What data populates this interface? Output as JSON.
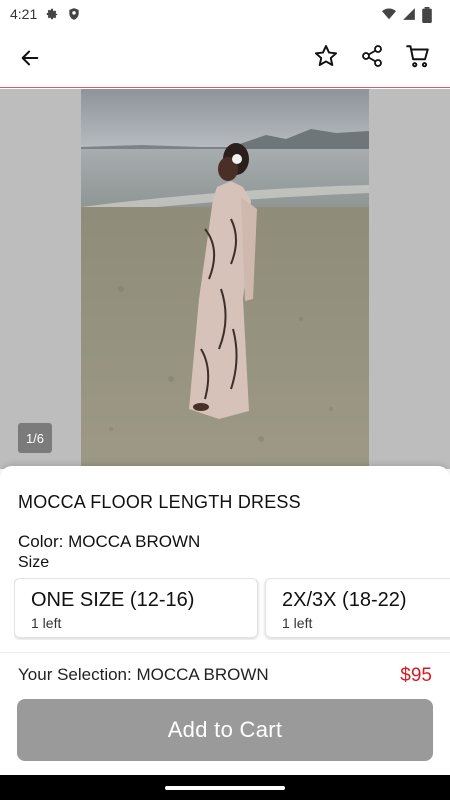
{
  "status_bar": {
    "time": "4:21",
    "icons": [
      "gear-icon",
      "shield-icon",
      "wifi-icon",
      "signal-icon",
      "battery-icon"
    ]
  },
  "app_bar": {
    "icons": [
      "back-arrow-icon",
      "star-outline-icon",
      "share-icon",
      "cart-icon"
    ],
    "accent_line_color": "#e05a6a"
  },
  "gallery": {
    "page_indicator": "1/6"
  },
  "product": {
    "title": "MOCCA FLOOR LENGTH DRESS",
    "color_line": "Color: MOCCA BROWN",
    "size_label": "Size",
    "sizes": [
      {
        "name": "ONE SIZE (12-16)",
        "stock": "1 left"
      },
      {
        "name": "2X/3X (18-22)",
        "stock": "1 left"
      }
    ],
    "selection": "Your Selection: MOCCA BROWN",
    "price": "$95",
    "price_color": "#d81b22",
    "add_to_cart": "Add to Cart"
  }
}
